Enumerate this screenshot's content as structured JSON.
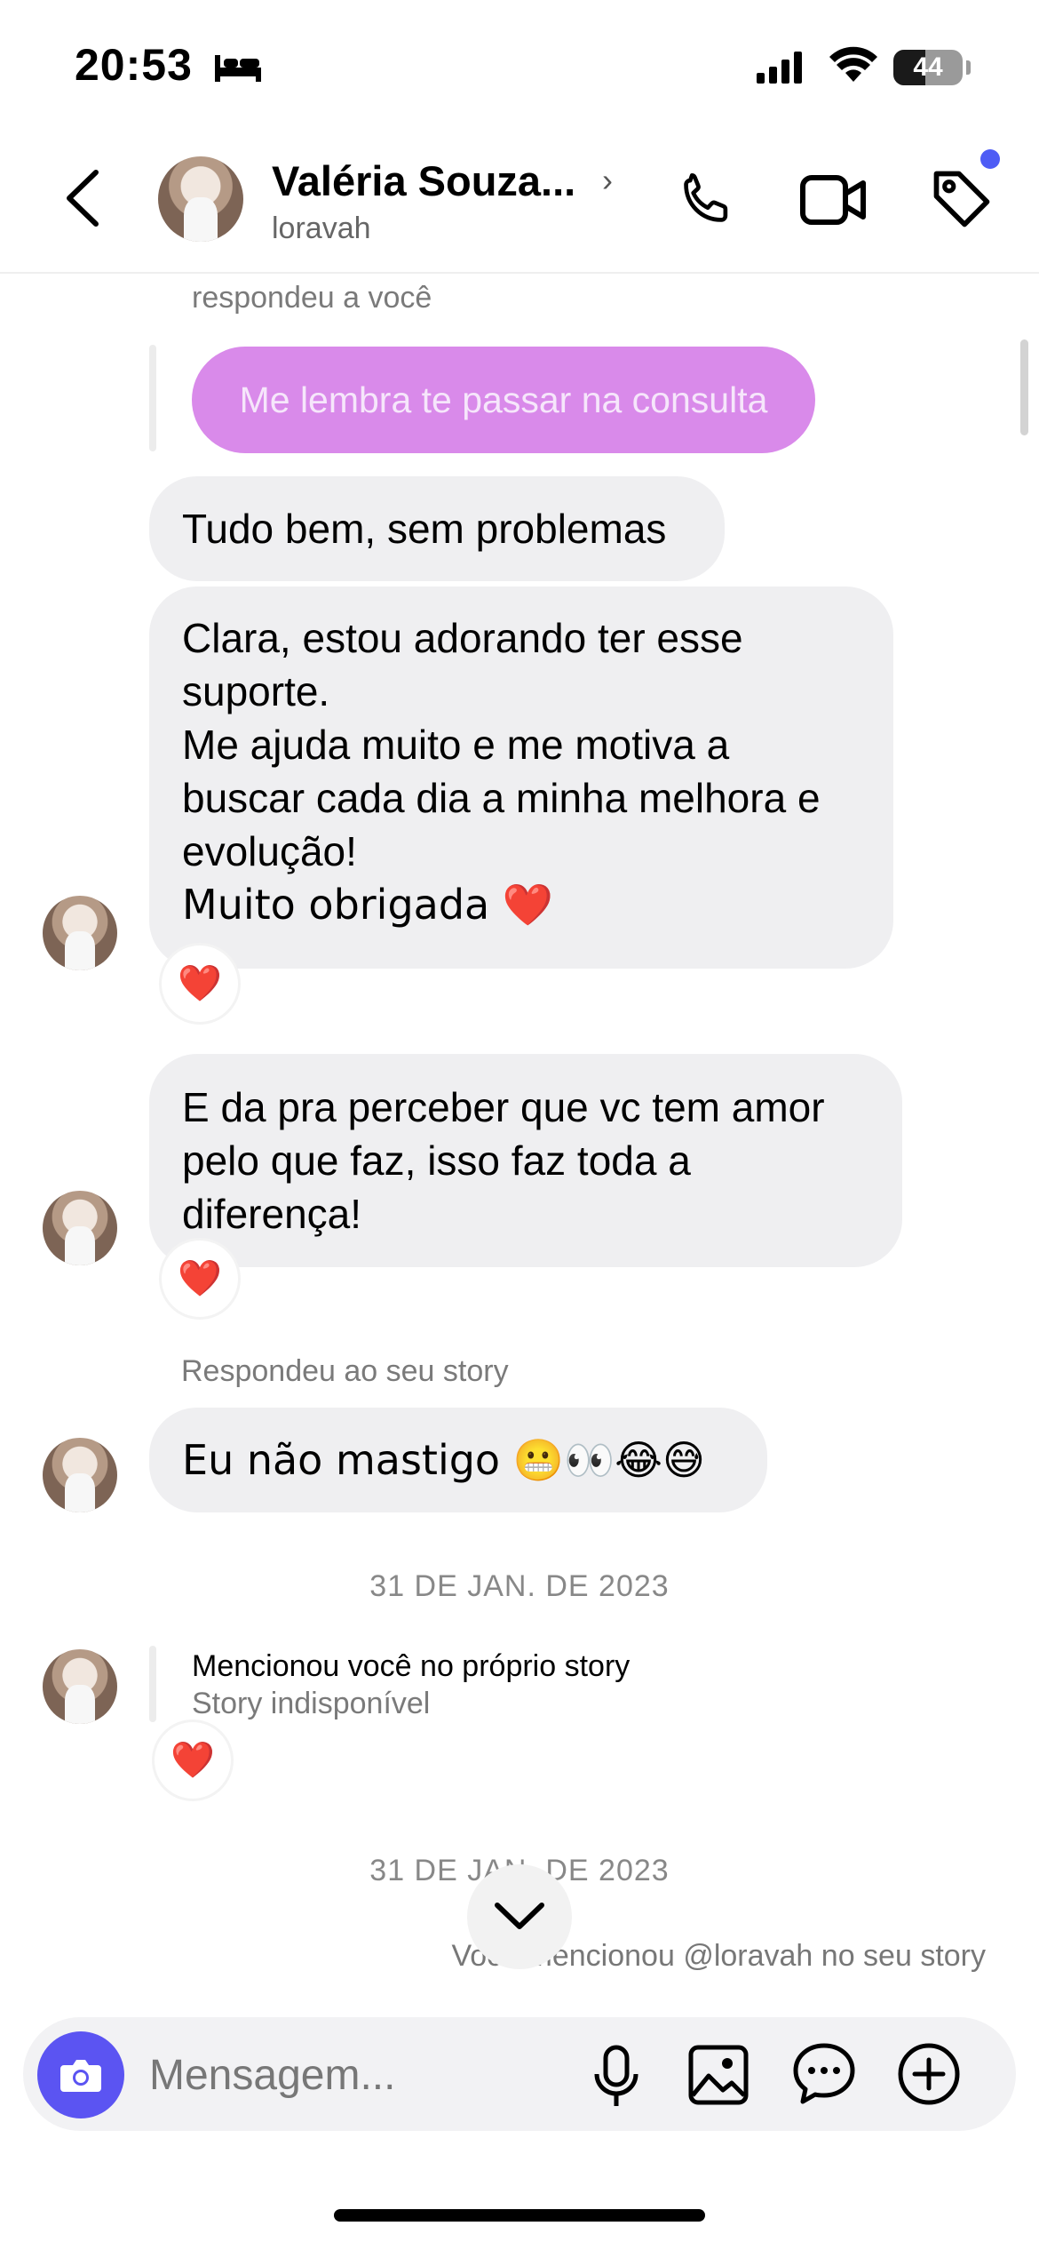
{
  "status_bar": {
    "time": "20:53",
    "battery": "44"
  },
  "header": {
    "name": "Valéria Souza...",
    "username": "loravah",
    "icons": [
      "back-chevron-icon",
      "phone-icon",
      "video-camera-icon",
      "tag-icon"
    ]
  },
  "thread": {
    "reply_label": "respondeu a você",
    "replied_message": "Me lembra te passar na consulta",
    "msg1": "Tudo bem, sem problemas",
    "msg2_lines": [
      "Clara, estou adorando ter esse",
      "suporte.",
      "Me ajuda muito e me motiva a",
      "buscar cada dia a minha melhora e",
      "evolução!",
      "Muito obrigada ❤️"
    ],
    "msg3_lines": [
      "E da pra perceber que vc tem amor",
      "pelo que faz, isso faz toda a",
      "diferença!"
    ],
    "reaction": "❤️",
    "story_reply_label": "Respondeu ao seu story",
    "msg4": "Eu não mastigo 😬👀😂😅",
    "date1": "31 DE JAN. DE 2023",
    "mention_title": "Mencionou você no próprio story",
    "mention_sub": "Story indisponível",
    "date2": "31 DE JAN. DE 2023",
    "you_mentioned": "Você mencionou @loravah no seu story"
  },
  "composer": {
    "placeholder": "Mensagem..."
  },
  "colors": {
    "accent": "#5b54f2",
    "sent_bubble": "#d98aea",
    "received_bubble": "#efeff1",
    "notification_dot": "#4e5cf5"
  }
}
